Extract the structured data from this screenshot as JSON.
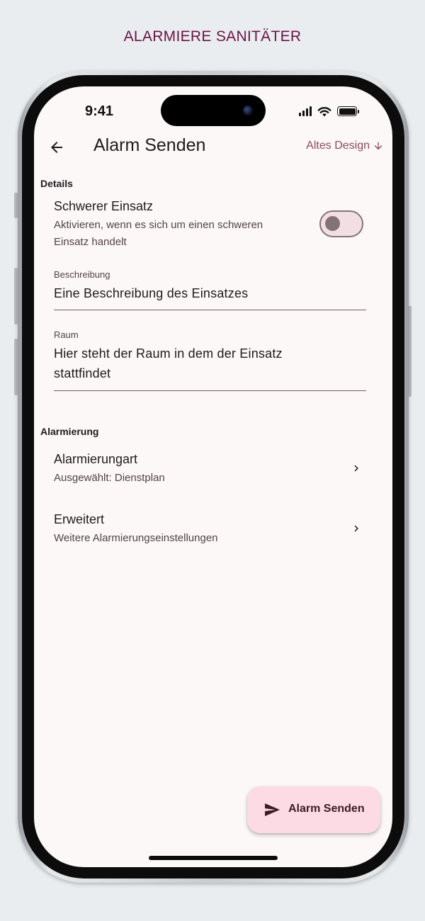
{
  "promo": {
    "title": "ALARMIERE SANITÄTER"
  },
  "status_bar": {
    "time": "9:41",
    "icons": [
      "signal-icon",
      "wifi-icon",
      "battery-icon"
    ]
  },
  "app_bar": {
    "title": "Alarm Senden",
    "back_icon": "arrow-left-icon",
    "old_design_label": "Altes Design",
    "old_design_icon": "arrow-down-icon"
  },
  "details": {
    "section_label": "Details",
    "severe": {
      "title": "Schwerer Einsatz",
      "subtitle_line1": "Aktivieren, wenn es sich um einen schweren",
      "subtitle_line2": "Einsatz handelt",
      "enabled": false
    },
    "description": {
      "label": "Beschreibung",
      "value": "Eine Beschreibung des Einsatzes"
    },
    "room": {
      "label": "Raum",
      "value_line1": "Hier steht der Raum in dem der Einsatz",
      "value_line2": "stattfindet"
    }
  },
  "alerting": {
    "section_label": "Alarmierung",
    "items": [
      {
        "title": "Alarmierungart",
        "subtitle": "Ausgewählt: Dienstplan",
        "icon": "chevron-right-icon"
      },
      {
        "title": "Erweitert",
        "subtitle": "Weitere Alarmierungseinstellungen",
        "icon": "chevron-right-icon"
      }
    ]
  },
  "fab": {
    "label": "Alarm Senden",
    "icon": "send-icon"
  },
  "colors": {
    "accent": "#8c4a5e",
    "background": "#fcf8f8",
    "fab": "#fddbe4",
    "promo_title": "#6b1446"
  }
}
